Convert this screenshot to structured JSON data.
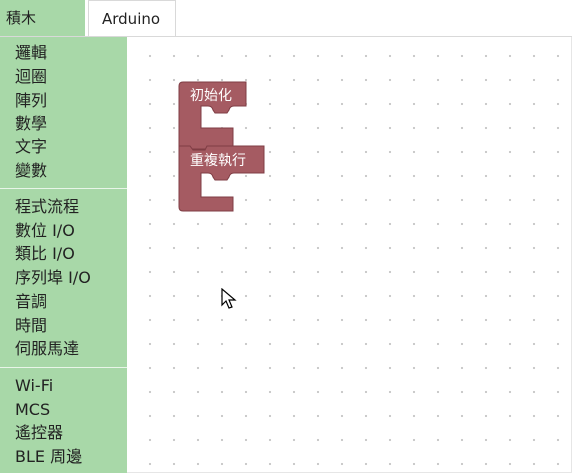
{
  "tabs": {
    "blocks_label": "積木",
    "arduino_label": "Arduino"
  },
  "toolbox": {
    "group1": [
      "邏輯",
      "迴圈",
      "陣列",
      "數學",
      "文字",
      "變數"
    ],
    "group2": [
      "程式流程",
      "數位 I/O",
      "類比 I/O",
      "序列埠 I/O",
      "音調",
      "時間",
      "伺服馬達"
    ],
    "group3": [
      "Wi-Fi",
      "MCS",
      "遙控器",
      "BLE 周邊"
    ]
  },
  "workspace": {
    "setup_block_label": "初始化",
    "loop_block_label": "重複執行",
    "block_color": "#a55b62"
  }
}
